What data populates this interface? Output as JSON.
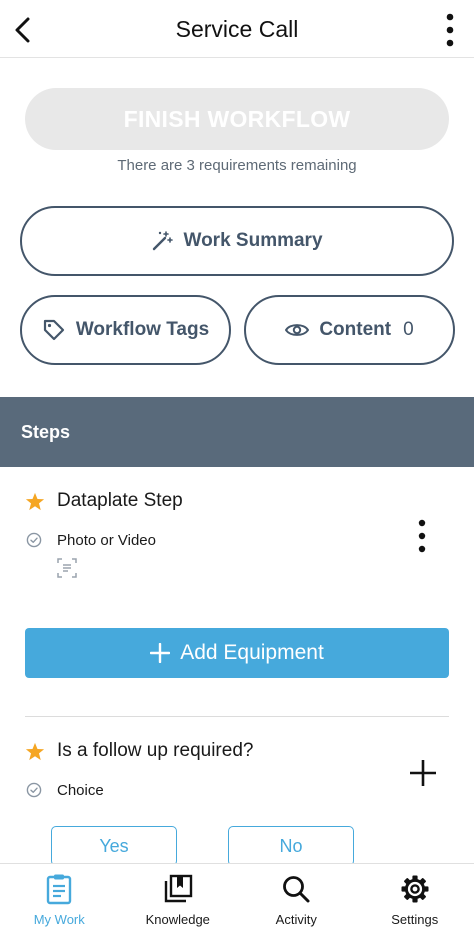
{
  "header": {
    "title": "Service Call"
  },
  "finish": {
    "label": "FINISH WORKFLOW",
    "requirements_text": "There are 3 requirements remaining"
  },
  "actions": {
    "work_summary": "Work Summary",
    "workflow_tags": "Workflow Tags",
    "content_label": "Content",
    "content_count": "0"
  },
  "steps_section": {
    "title": "Steps"
  },
  "steps": [
    {
      "title": "Dataplate Step",
      "type": "Photo or Video"
    },
    {
      "title": "Is a follow up required?",
      "type": "Choice",
      "options": [
        "Yes",
        "No"
      ]
    }
  ],
  "add_equipment": {
    "label": "Add Equipment"
  },
  "tabbar": {
    "tabs": [
      {
        "label": "My Work",
        "icon": "clipboard-icon",
        "active": true
      },
      {
        "label": "Knowledge",
        "icon": "book-icon",
        "active": false
      },
      {
        "label": "Activity",
        "icon": "search-icon",
        "active": false
      },
      {
        "label": "Settings",
        "icon": "gear-icon",
        "active": false
      }
    ]
  },
  "colors": {
    "accent": "#46a9dc",
    "slate": "#44566a",
    "steps_bar": "#596a7b",
    "star": "#f5a623",
    "disabled_button": "#e8e8e8"
  }
}
